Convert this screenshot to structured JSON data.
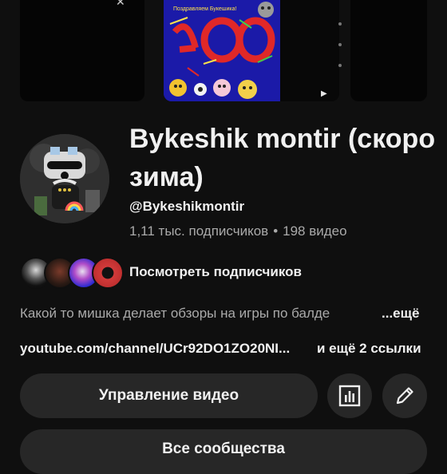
{
  "channel": {
    "title": "Bykeshik montir (скоро зима)",
    "handle": "@Bykeshikmontir",
    "subscribers": "1,11 тыс. подписчиков",
    "separator": "•",
    "videos": "198 видео"
  },
  "subscribers_row": {
    "label": "Посмотреть подписчиков"
  },
  "description": {
    "text": "Какой то мишка делает обзоры на игры по балде",
    "more": "...ещё"
  },
  "links": {
    "url": "youtube.com/channel/UCr92DO1ZO20NI...",
    "more": "и ещё 2 ссылки"
  },
  "buttons": {
    "manage_videos": "Управление видео",
    "bottom": "Все сообщества"
  },
  "thumbnail": {
    "banner_text": "Поздравляем Букешика!",
    "big_number": "400"
  },
  "icons": {
    "stats": "bar-chart-icon",
    "edit": "pencil-icon",
    "close": "close-icon",
    "play": "play-icon"
  },
  "colors": {
    "background": "#0f0f0f",
    "button": "#272727",
    "text_primary": "#f1f1f1",
    "text_secondary": "#aaaaaa",
    "thumbnail_blue": "#1b1aa8"
  }
}
